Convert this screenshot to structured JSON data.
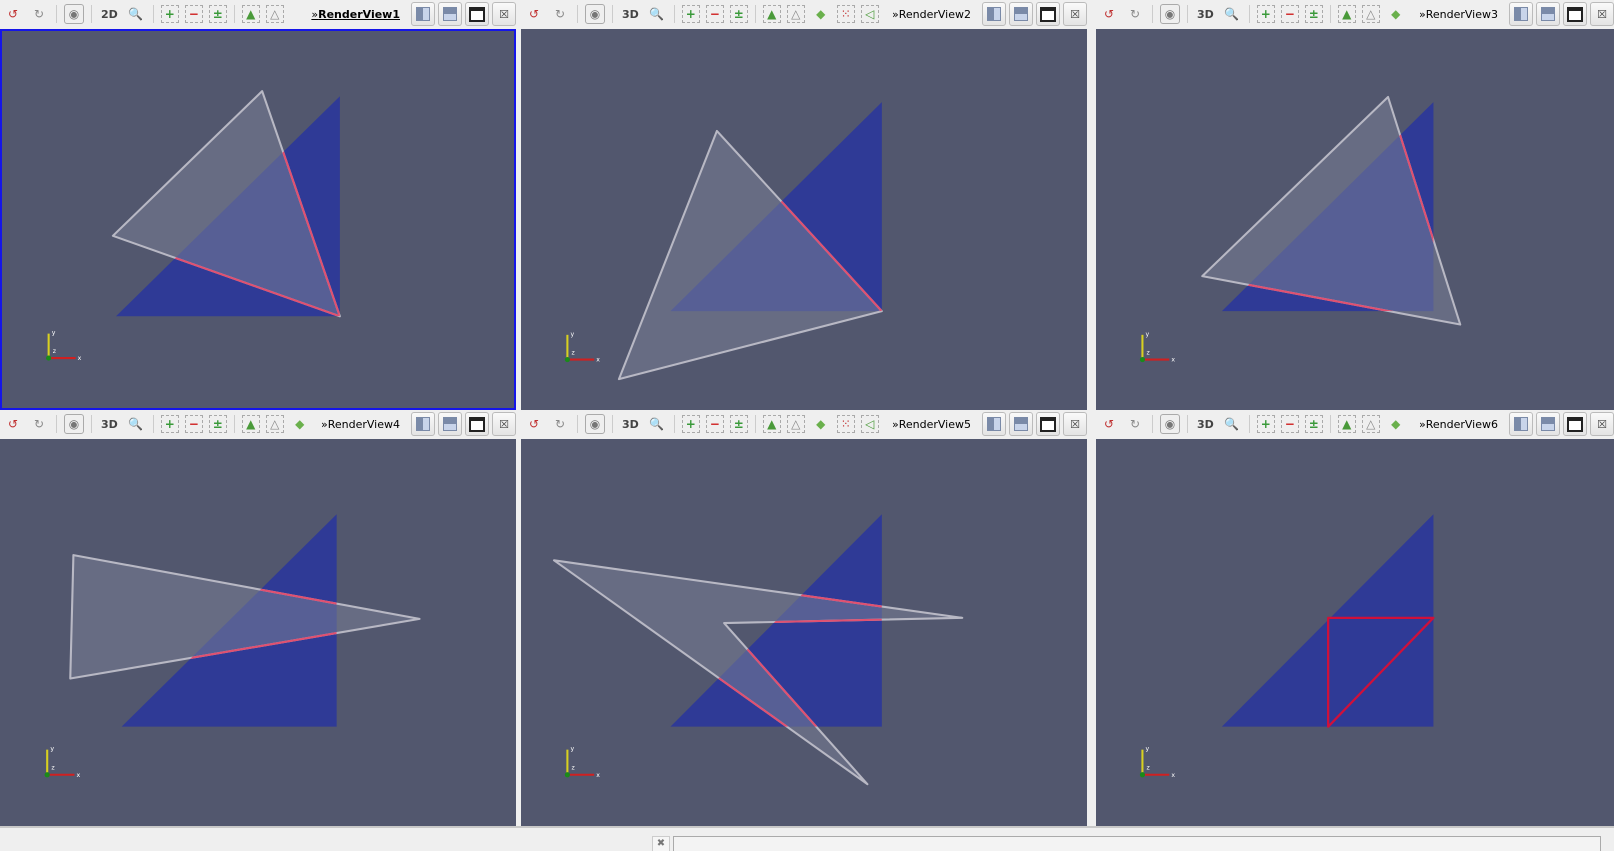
{
  "views": [
    {
      "title": "RenderView1",
      "mode": "2D",
      "active": true,
      "icons": [
        "reset-camera",
        "reset-camera-closest",
        "sep",
        "screenshot",
        "sep",
        "mode",
        "zoom-to-box",
        "sep",
        "zoom-in",
        "zoom-out",
        "zoom-to-data",
        "sep",
        "select-points-on",
        "select-points-through"
      ]
    },
    {
      "title": "RenderView2",
      "mode": "3D",
      "active": false,
      "icons": [
        "reset-camera",
        "reset-camera-closest",
        "sep",
        "screenshot",
        "sep",
        "mode",
        "zoom-to-box",
        "sep",
        "zoom-in",
        "zoom-out",
        "zoom-to-data",
        "sep",
        "select-points-on",
        "select-points-through",
        "select-block",
        "interactive-select",
        "select-polygon"
      ]
    },
    {
      "title": "RenderView3",
      "mode": "3D",
      "active": false,
      "icons": [
        "reset-camera",
        "reset-camera-closest",
        "sep",
        "screenshot",
        "sep",
        "mode",
        "zoom-to-box",
        "sep",
        "zoom-in",
        "zoom-out",
        "zoom-to-data",
        "sep",
        "select-points-on",
        "select-points-through",
        "select-block"
      ]
    },
    {
      "title": "RenderView4",
      "mode": "3D",
      "active": false,
      "icons": [
        "reset-camera",
        "reset-camera-closest",
        "sep",
        "screenshot",
        "sep",
        "mode",
        "zoom-to-box",
        "sep",
        "zoom-in",
        "zoom-out",
        "zoom-to-data",
        "sep",
        "select-points-on",
        "select-points-through",
        "select-block"
      ]
    },
    {
      "title": "RenderView5",
      "mode": "3D",
      "active": false,
      "icons": [
        "reset-camera",
        "reset-camera-closest",
        "sep",
        "screenshot",
        "sep",
        "mode",
        "zoom-to-box",
        "sep",
        "zoom-in",
        "zoom-out",
        "zoom-to-data",
        "sep",
        "select-points-on",
        "select-points-through",
        "select-block",
        "interactive-select",
        "select-polygon"
      ]
    },
    {
      "title": "RenderView6",
      "mode": "3D",
      "active": false,
      "icons": [
        "reset-camera",
        "reset-camera-closest",
        "sep",
        "screenshot",
        "sep",
        "mode",
        "zoom-to-box",
        "sep",
        "zoom-in",
        "zoom-out",
        "zoom-to-data",
        "sep",
        "select-points-on",
        "select-points-through",
        "select-block"
      ]
    }
  ],
  "view_title_prefix": "»",
  "axes": {
    "x": "x",
    "y": "y",
    "z": "z"
  },
  "colors": {
    "background": "#52576e",
    "surface": "#2f3a96",
    "outline": "#b8b8c4",
    "selection": "#e05070",
    "active_border": "#1515e8"
  }
}
